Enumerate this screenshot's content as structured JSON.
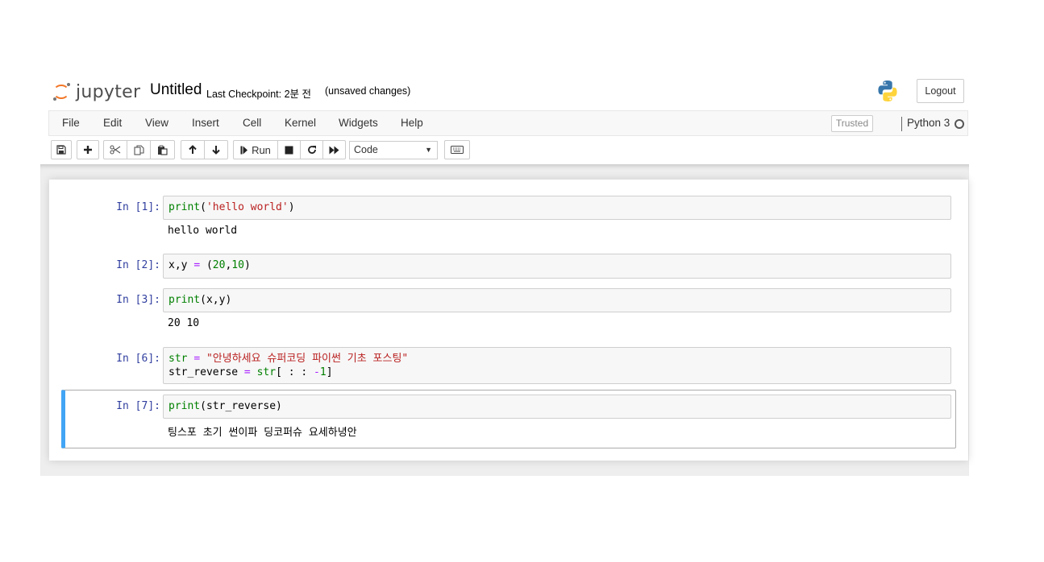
{
  "header": {
    "logo_text": "jupyter",
    "notebook_title": "Untitled",
    "checkpoint": "Last Checkpoint: 2분 전",
    "autosave_status": "(unsaved changes)",
    "logout_label": "Logout"
  },
  "menubar": {
    "items": [
      "File",
      "Edit",
      "View",
      "Insert",
      "Cell",
      "Kernel",
      "Widgets",
      "Help"
    ],
    "trusted_label": "Trusted",
    "kernel_name": "Python 3"
  },
  "toolbar": {
    "run_label": "Run",
    "cell_type": "Code",
    "buttons": [
      "save-icon",
      "plus-icon",
      "cut-icon",
      "copy-icon",
      "paste-icon",
      "arrow-up-icon",
      "arrow-down-icon",
      "run-icon",
      "stop-icon",
      "restart-icon",
      "fast-forward-icon",
      "keyboard-icon"
    ]
  },
  "cells": [
    {
      "prompt": "In [1]:",
      "code": [
        [
          {
            "t": "print",
            "c": "kw"
          },
          {
            "t": "(",
            "c": "p"
          },
          {
            "t": "'hello world'",
            "c": "st"
          },
          {
            "t": ")",
            "c": "p"
          }
        ]
      ],
      "output": "hello world"
    },
    {
      "prompt": "In [2]:",
      "code": [
        [
          {
            "t": "x,y ",
            "c": "p"
          },
          {
            "t": "=",
            "c": "op"
          },
          {
            "t": " (",
            "c": "p"
          },
          {
            "t": "20",
            "c": "nm"
          },
          {
            "t": ",",
            "c": "p"
          },
          {
            "t": "10",
            "c": "nm"
          },
          {
            "t": ")",
            "c": "p"
          }
        ]
      ],
      "output": ""
    },
    {
      "prompt": "In [3]:",
      "code": [
        [
          {
            "t": "print",
            "c": "kw"
          },
          {
            "t": "(x,y)",
            "c": "p"
          }
        ]
      ],
      "output": "20 10"
    },
    {
      "prompt": "In [6]:",
      "code": [
        [
          {
            "t": "str",
            "c": "kw"
          },
          {
            "t": " ",
            "c": "p"
          },
          {
            "t": "=",
            "c": "op"
          },
          {
            "t": " ",
            "c": "p"
          },
          {
            "t": "\"안녕하세요 슈퍼코딩 파이썬 기초 포스팅\"",
            "c": "st"
          }
        ],
        [
          {
            "t": "str_reverse ",
            "c": "p"
          },
          {
            "t": "=",
            "c": "op"
          },
          {
            "t": " ",
            "c": "p"
          },
          {
            "t": "str",
            "c": "kw"
          },
          {
            "t": "[ : : ",
            "c": "p"
          },
          {
            "t": "-",
            "c": "op"
          },
          {
            "t": "1",
            "c": "nm"
          },
          {
            "t": "]",
            "c": "p"
          }
        ]
      ],
      "output": ""
    },
    {
      "prompt": "In [7]:",
      "code": [
        [
          {
            "t": "print",
            "c": "kw"
          },
          {
            "t": "(str_reverse)",
            "c": "p"
          }
        ]
      ],
      "output": "팅스포 초기 썬이파 딩코퍼슈 요세하녕안",
      "selected": true
    }
  ],
  "colors": {
    "accent_selected": "#42a5f5",
    "prompt": "#303f9f",
    "logo_orange": "#f37626"
  }
}
